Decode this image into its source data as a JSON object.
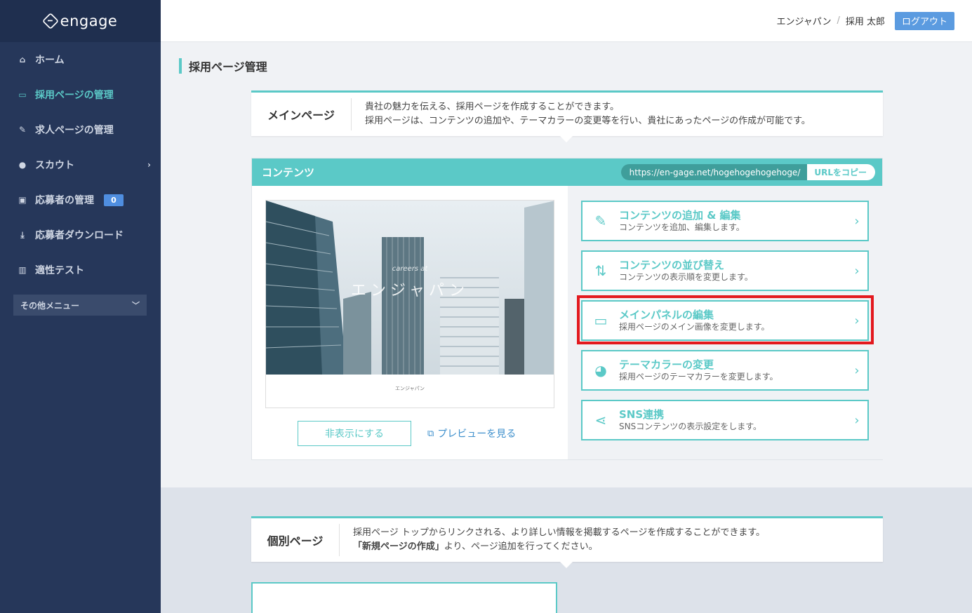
{
  "brand": {
    "name": "engage"
  },
  "sidebar": {
    "items": [
      {
        "label": "ホーム",
        "icon": "home-icon",
        "glyph": "⌂"
      },
      {
        "label": "採用ページの管理",
        "icon": "laptop-icon",
        "glyph": "▭",
        "active": true
      },
      {
        "label": "求人ページの管理",
        "icon": "edit-icon",
        "glyph": "✎"
      },
      {
        "label": "スカウト",
        "icon": "user-icon",
        "glyph": "●"
      },
      {
        "label": "応募者の管理",
        "icon": "download-box-icon",
        "glyph": "▣",
        "badge": "0"
      },
      {
        "label": "応募者ダウンロード",
        "icon": "download-icon",
        "glyph": "⤓"
      },
      {
        "label": "適性テスト",
        "icon": "bar-chart-icon",
        "glyph": "▥"
      }
    ],
    "other_menu": "その他メニュー"
  },
  "header": {
    "company": "エンジャパン",
    "separator": "/",
    "user": "採用 太郎",
    "logout": "ログアウト"
  },
  "page_title": "採用ページ管理",
  "main_page": {
    "label": "メインページ",
    "desc_line1": "貴社の魅力を伝える、採用ページを作成することができます。",
    "desc_line2": "採用ページは、コンテンツの追加や、テーマカラーの変更等を行い、貴社にあったページの作成が可能です。"
  },
  "contents": {
    "title": "コンテンツ",
    "url": "https://en-gage.net/hogehogehogehoge/",
    "copy_label": "URLをコピー",
    "preview": {
      "overlay_sub": "careers at",
      "overlay_title": "エンジャパン",
      "caption": "エンジャパン"
    },
    "hide_button": "非表示にする",
    "preview_link": "プレビューを見る",
    "actions": [
      {
        "title": "コンテンツの追加 & 編集",
        "sub": "コンテンツを追加、編集します。",
        "icon": "pencil-icon",
        "glyph": "✎"
      },
      {
        "title": "コンテンツの並び替え",
        "sub": "コンテンツの表示順を変更します。",
        "icon": "sort-icon",
        "glyph": "⇅"
      },
      {
        "title": "メインパネルの編集",
        "sub": "採用ページのメイン画像を変更します。",
        "icon": "panel-image-icon",
        "glyph": "▭"
      },
      {
        "title": "テーマカラーの変更",
        "sub": "採用ページのテーマカラーを変更します。",
        "icon": "palette-icon",
        "glyph": "◕"
      },
      {
        "title": "SNS連携",
        "sub": "SNSコンテンツの表示設定をします。",
        "icon": "share-icon",
        "glyph": "⋖"
      }
    ]
  },
  "individual_page": {
    "label": "個別ページ",
    "desc_line1": "採用ページ トップからリンクされる、より詳しい情報を掲載するページを作成することができます。",
    "desc_line2_bold": "「新規ページの作成」",
    "desc_line2_rest": "より、ページ追加を行ってください。"
  },
  "colors": {
    "accent": "#5bc9c7",
    "sidebar": "#26375a",
    "highlight": "#e3191e"
  }
}
